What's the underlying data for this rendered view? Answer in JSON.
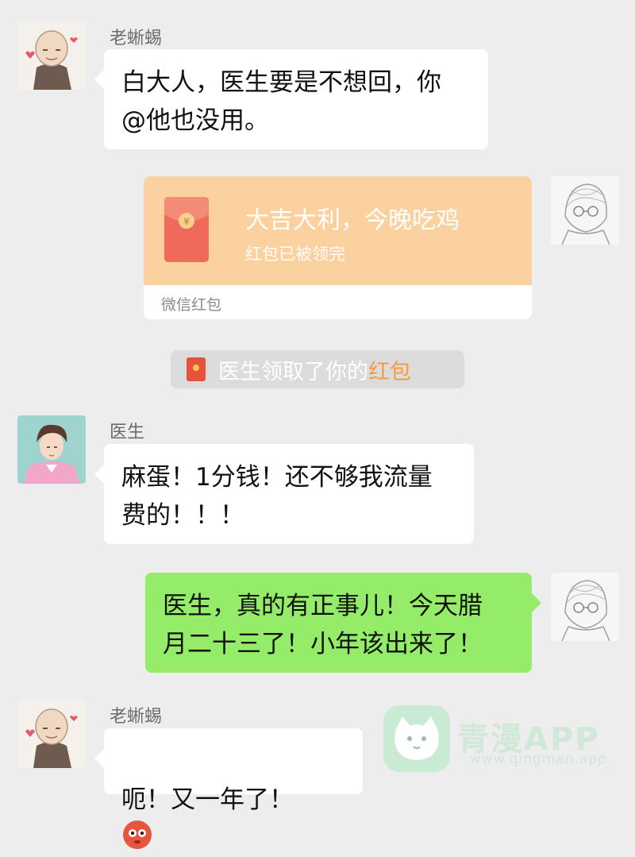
{
  "messages": [
    {
      "sender": "老蜥蜴",
      "text": "白大人，医生要是不想回，你\n@他也没用。"
    },
    {
      "red_packet": {
        "title": "大吉大利，今晚吃鸡",
        "status": "红包已被领完",
        "footer": "微信红包"
      }
    },
    {
      "notice": {
        "prefix": "医生领取了你的",
        "highlight": "红包"
      }
    },
    {
      "sender": "医生",
      "text": "麻蛋！1分钱！还不够我流量\n费的！！！"
    },
    {
      "text": "医生，真的有正事儿！今天腊\n月二十三了！小年该出来了！"
    },
    {
      "sender": "老蜥蜴",
      "text": "呃！又一年了！"
    }
  ],
  "watermark": {
    "title": "青漫APP",
    "url": "www.qingman.app"
  },
  "colors": {
    "background": "#ededed",
    "bubble_left": "#ffffff",
    "bubble_right": "#95ec69",
    "red_packet": "#fcd1a0",
    "notice_highlight": "#f39c3d"
  }
}
